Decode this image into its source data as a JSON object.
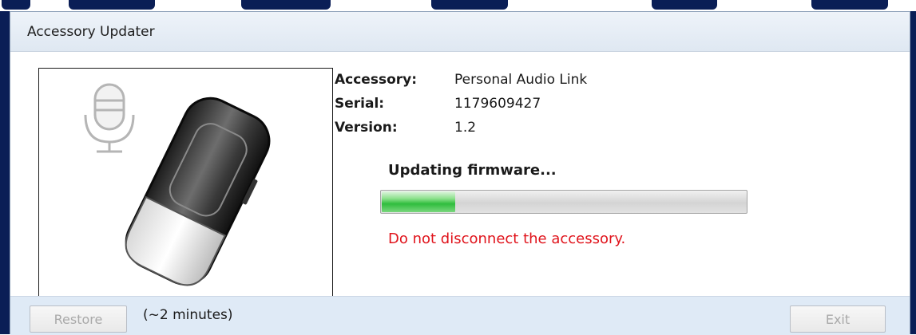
{
  "window": {
    "title": "Accessory Updater"
  },
  "device": {
    "image_icon": "microphone-icon",
    "fields": [
      {
        "label": "Accessory:",
        "value": "Personal Audio Link"
      },
      {
        "label": "Serial:",
        "value": "1179609427"
      },
      {
        "label": "Version:",
        "value": "1.2"
      }
    ]
  },
  "update": {
    "status": "Updating firmware...",
    "progress_percent": 20,
    "warning": "Do not disconnect the accessory.",
    "warning_color": "#e0131b"
  },
  "footer": {
    "restore_label": "Restore",
    "time_estimate": "(~2 minutes)",
    "exit_label": "Exit"
  },
  "colors": {
    "frame": "#0a1e56",
    "footer_bg": "#dfeaf6",
    "progress_green": "#2fbd3d"
  }
}
